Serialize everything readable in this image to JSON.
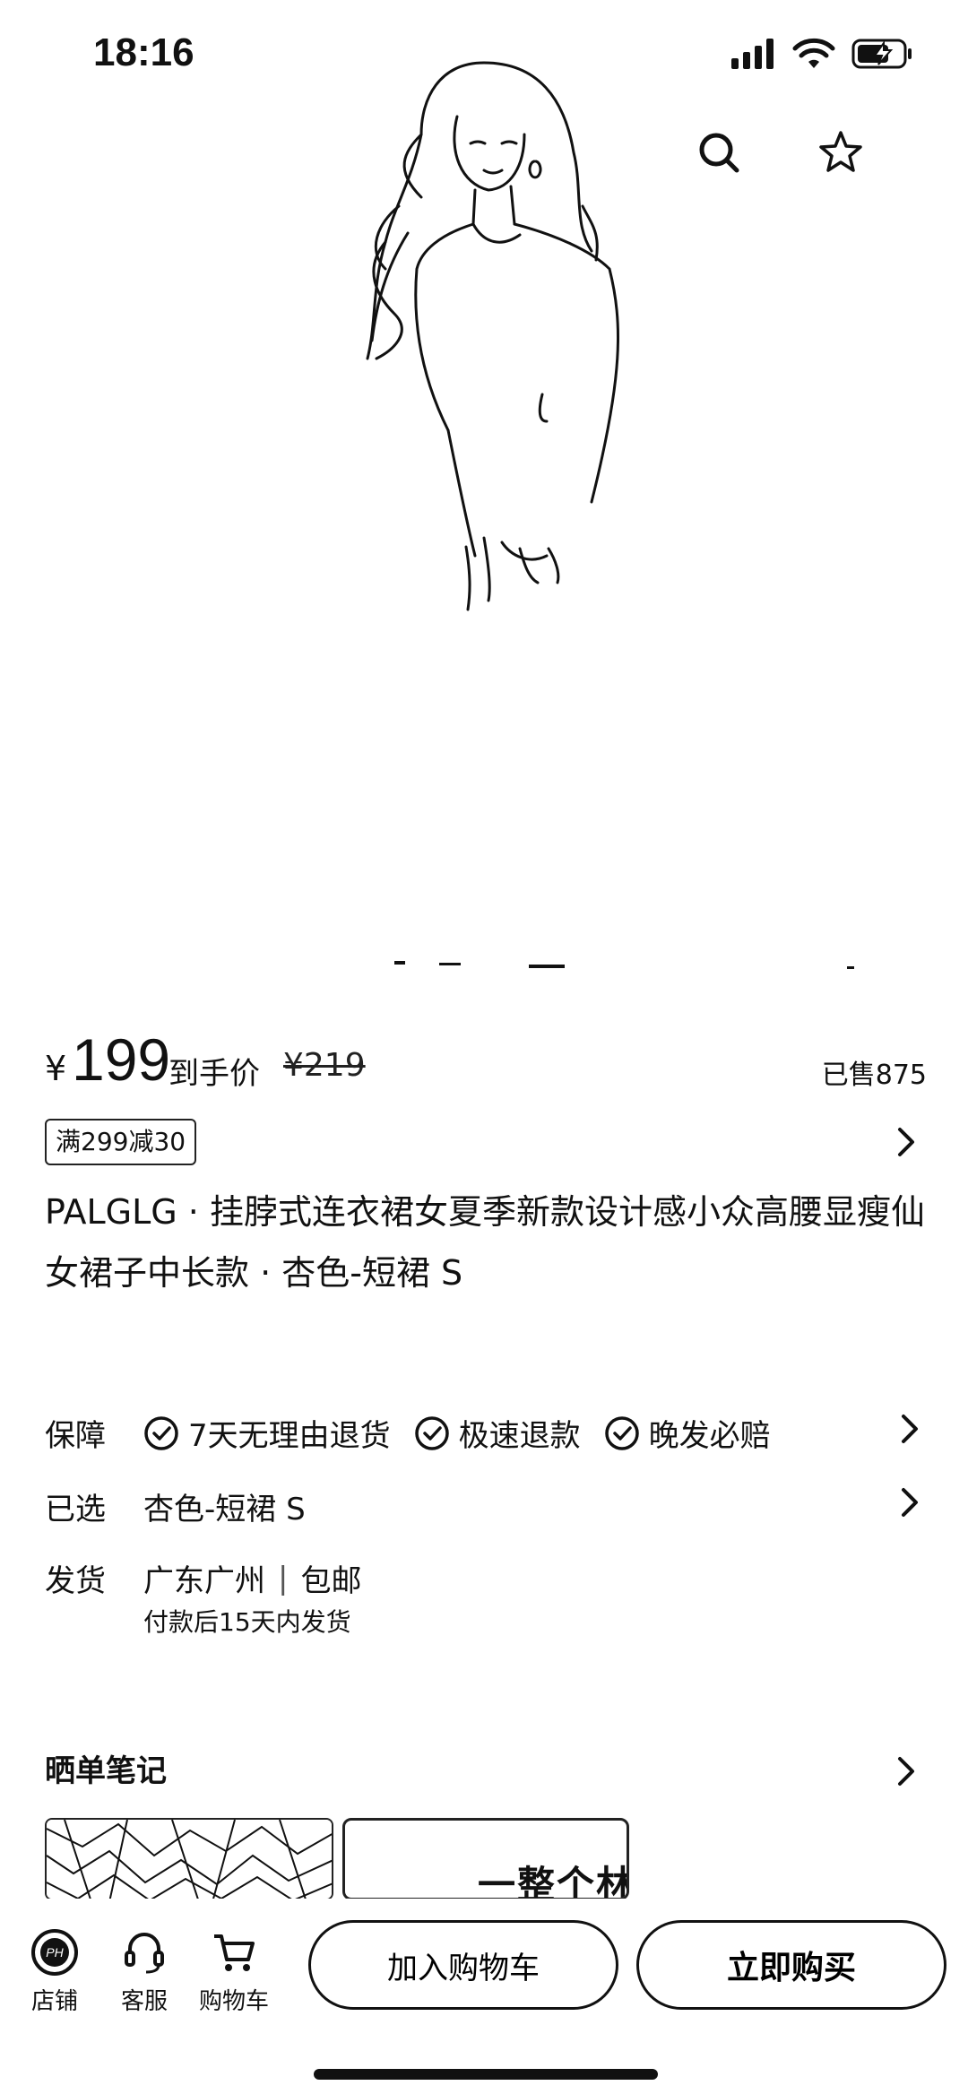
{
  "status": {
    "time": "18:16"
  },
  "price": {
    "currency": "¥",
    "value": "199",
    "label": "到手价",
    "original": "¥219",
    "sold": "已售875"
  },
  "coupon": "满299减30",
  "product_title": "PALGLG · 挂脖式连衣裙女夏季新款设计感小众高腰显瘦仙女裙子中长款 · 杏色-短裙 S",
  "guarantee": {
    "label": "保障",
    "items": [
      "7天无理由退货",
      "极速退款",
      "晚发必赔"
    ]
  },
  "selected": {
    "label": "已选",
    "value": "杏色-短裙 S"
  },
  "shipping": {
    "label": "发货",
    "from": "广东广州",
    "separator": "|",
    "postage": "包邮",
    "note": "付款后15天内发货"
  },
  "notes": {
    "title": "晒单笔记",
    "thumb2_text": "一整个林"
  },
  "bottom_nav": {
    "store": "店铺",
    "service": "客服",
    "cart": "购物车"
  },
  "buttons": {
    "add_to_cart": "加入购物车",
    "buy_now": "立即购买"
  },
  "icons": [
    "signal-icon",
    "wifi-icon",
    "battery-icon",
    "search-icon",
    "star-icon",
    "check-circle-icon",
    "chevron-right-icon",
    "store-icon",
    "headset-icon",
    "cart-icon"
  ]
}
